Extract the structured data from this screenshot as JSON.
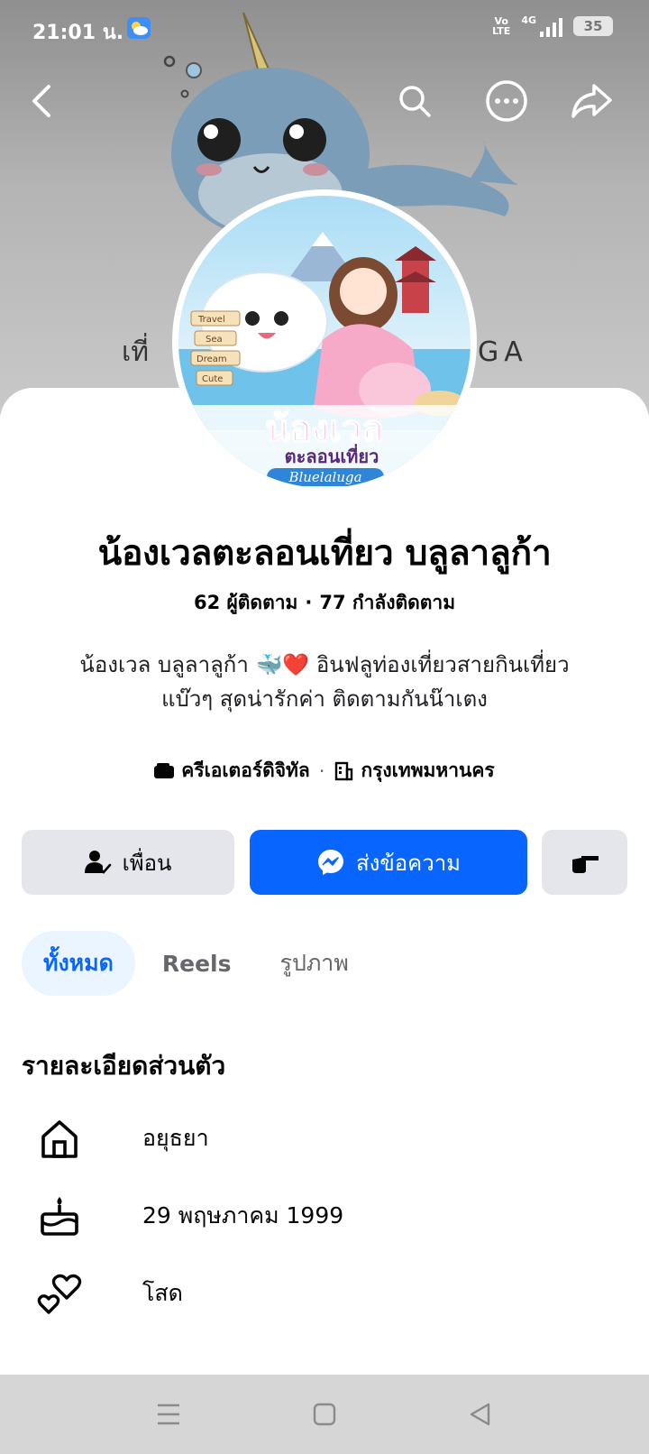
{
  "status_bar": {
    "time": "21:01 น.",
    "network": "4G",
    "volte_top": "Vo",
    "volte_bottom": "LTE",
    "battery": "35"
  },
  "cover": {
    "text_left": "เที่",
    "text_right": "GA"
  },
  "avatar": {
    "title": "น้องเวล",
    "subtitle": "ตะลอนเที่ยว",
    "brand": "Bluelaluga",
    "signs": [
      "Travel",
      "Sea",
      "Dream",
      "Cute"
    ]
  },
  "profile": {
    "name": "น้องเวลตะลอนเที่ยว บลูลาลูก้า",
    "followers": "62 ผู้ติดตาม",
    "following": "77 กำลังติดตาม",
    "bio_line1": "น้องเวล บลูลาลูก้า 🐳❤️ อินฟลูท่องเที่ยวสายกินเที่ยว",
    "bio_line2": "แบ๊วๆ สุดน่ารักค่า ติดตามกันน๊าเตง",
    "category": "ครีเอเตอร์ดิจิทัล",
    "location": "กรุงเทพมหานคร"
  },
  "actions": {
    "friend": "เพื่อน",
    "message": "ส่งข้อความ"
  },
  "tabs": [
    {
      "label": "ทั้งหมด"
    },
    {
      "label": "Reels"
    },
    {
      "label": "รูปภาพ"
    }
  ],
  "details": {
    "title": "รายละเอียดส่วนตัว",
    "items": [
      {
        "icon": "home-icon",
        "text": "อยุธยา"
      },
      {
        "icon": "birthday-cake-icon",
        "text": "29 พฤษภาคม  1999"
      },
      {
        "icon": "hearts-icon",
        "text": "โสด"
      }
    ]
  },
  "colors": {
    "accent": "#0866ff",
    "button_gray": "#e4e6eb",
    "tab_active_bg": "#ebf5ff"
  }
}
